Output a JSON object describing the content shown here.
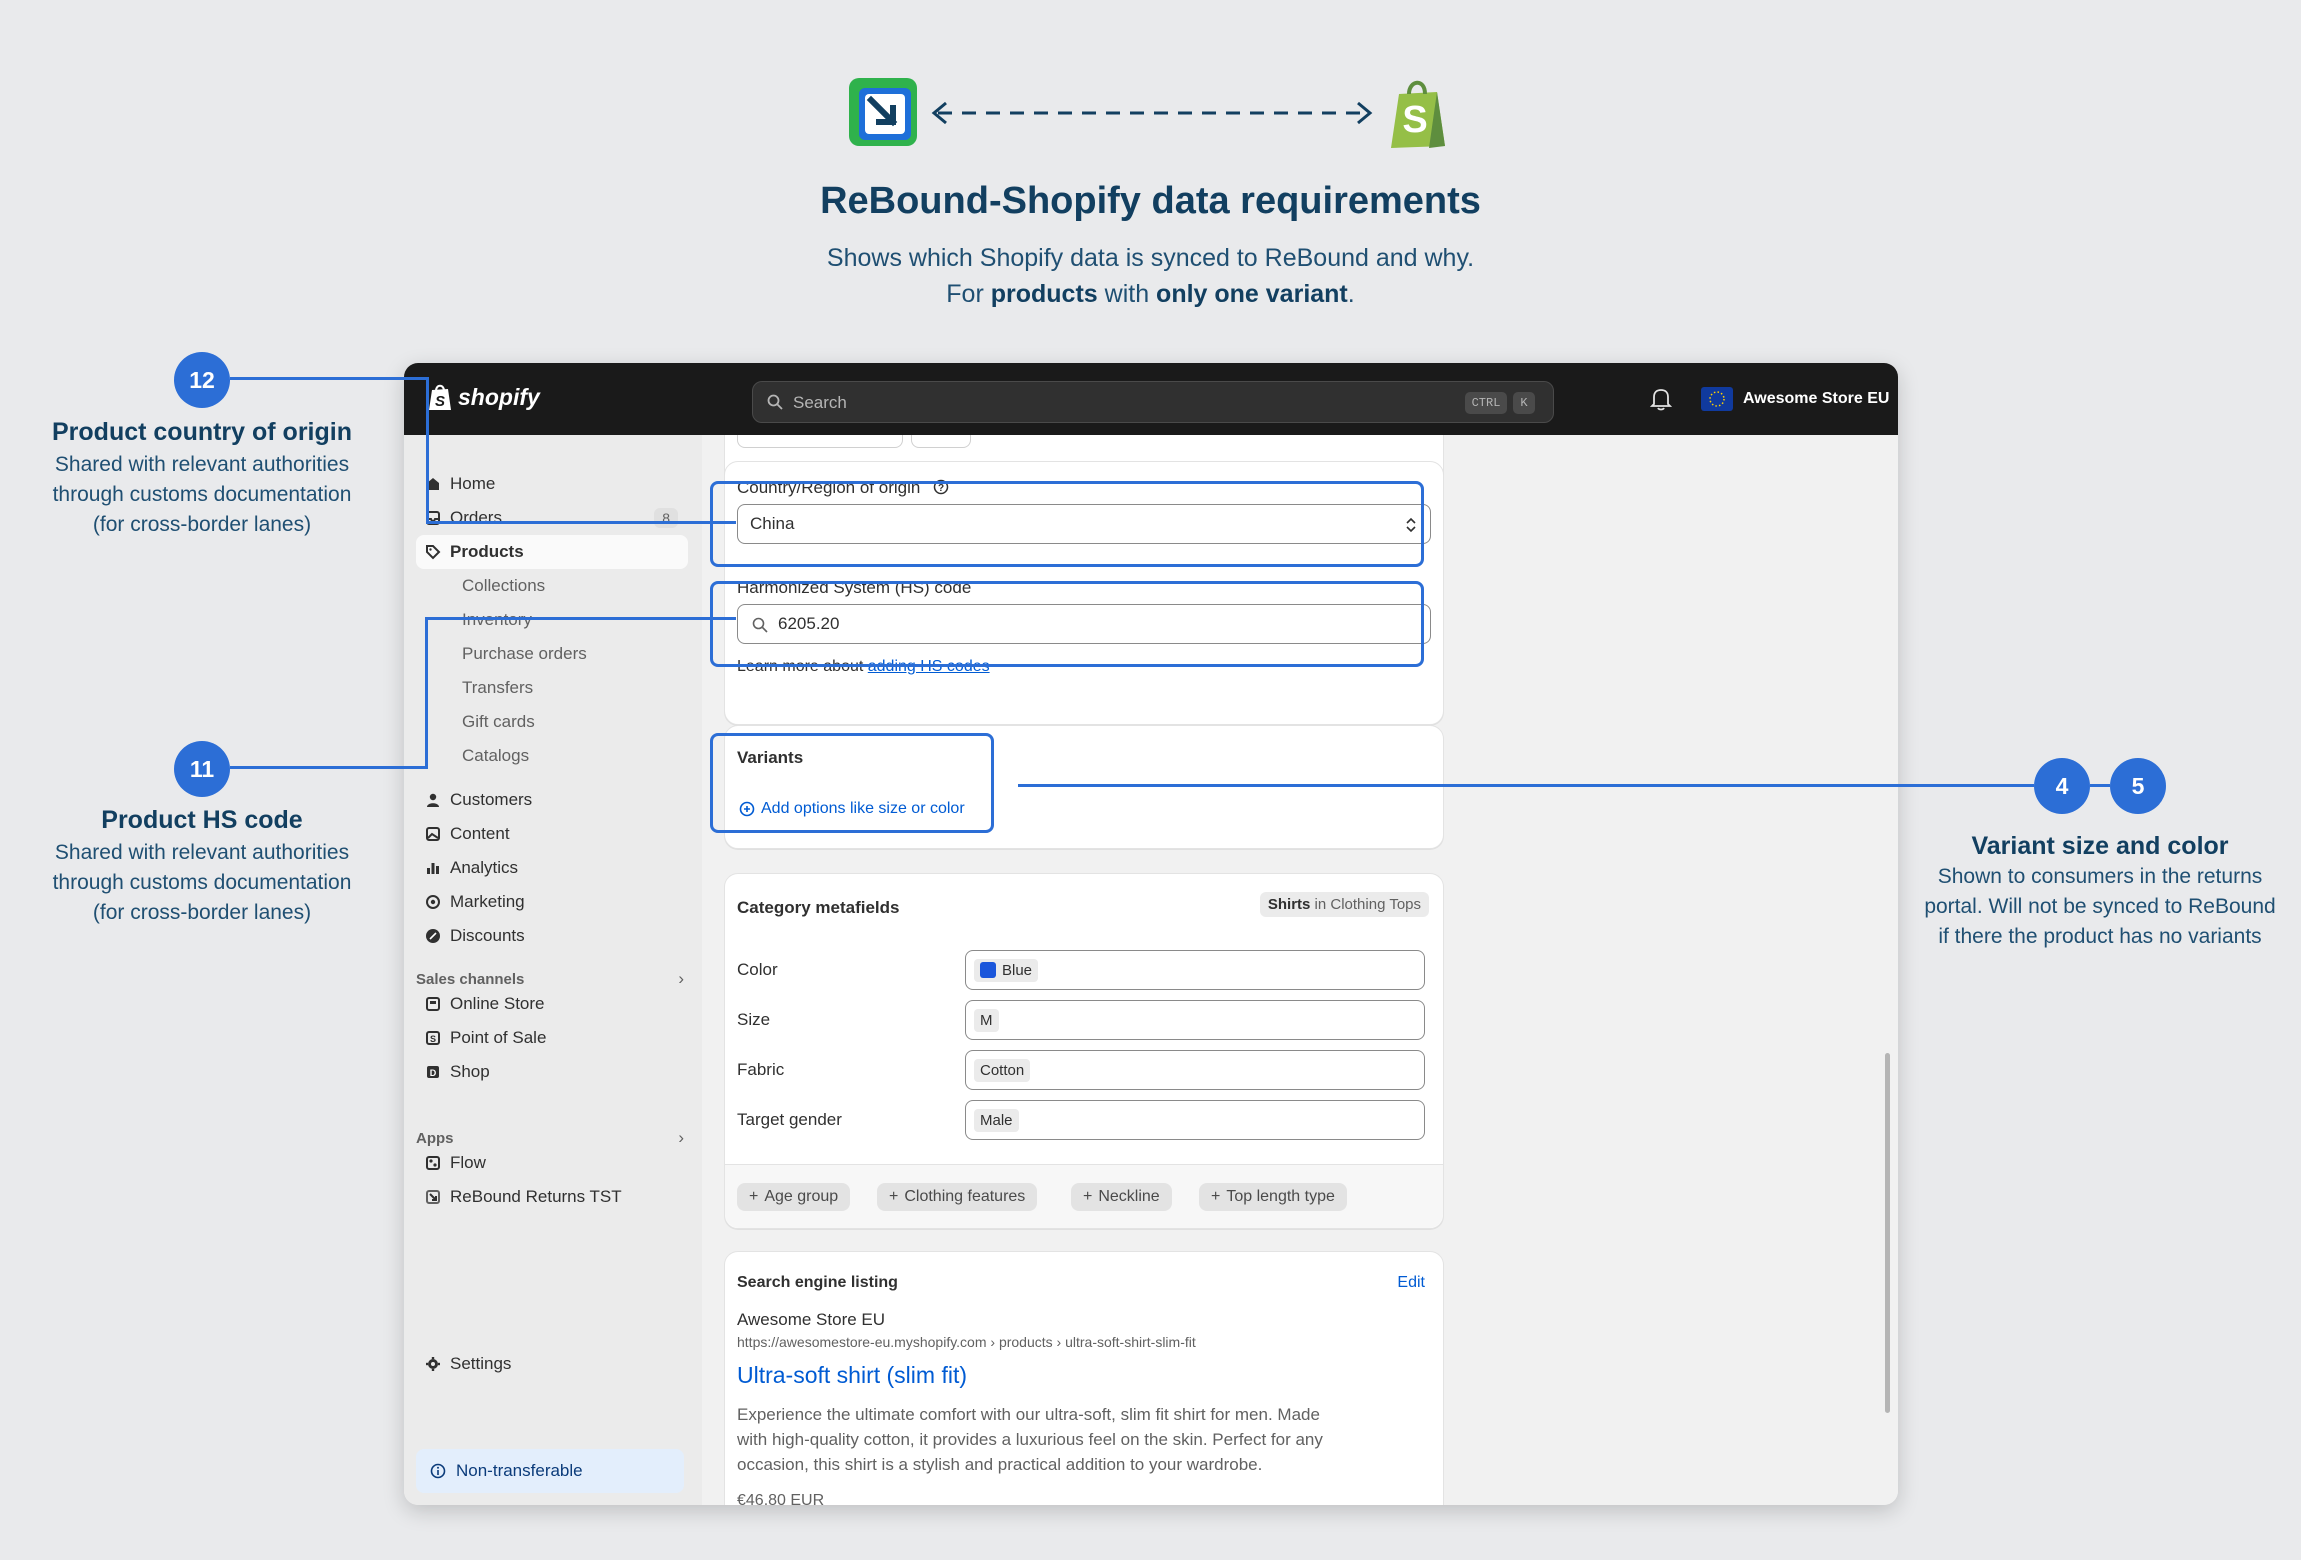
{
  "header": {
    "title": "ReBound-Shopify data requirements",
    "subtitle_line1": "Shows which Shopify data is synced to ReBound and why.",
    "subtitle_for": "For ",
    "subtitle_products": "products",
    "subtitle_with": " with ",
    "subtitle_variant": "only one variant",
    "subtitle_end": "."
  },
  "annotations": {
    "a12": {
      "badge": "12",
      "title": "Product country of origin",
      "lines": [
        "Shared with relevant authorities",
        "through customs documentation",
        "(for cross-border lanes)"
      ]
    },
    "a11": {
      "badge": "11",
      "title": "Product HS code",
      "lines": [
        "Shared with relevant authorities",
        "through customs documentation",
        "(for cross-border lanes)"
      ]
    },
    "a45": {
      "badge1": "4",
      "badge2": "5",
      "title": "Variant size and color",
      "lines": [
        "Shown to consumers in the returns",
        "portal. Will not be synced to ReBound",
        "if there the product has no variants"
      ]
    }
  },
  "topbar": {
    "brand": "shopify",
    "search_placeholder": "Search",
    "kbd1": "CTRL",
    "kbd2": "K",
    "store_name": "Awesome Store EU"
  },
  "sidebar": {
    "home": "Home",
    "orders": "Orders",
    "orders_count": "8",
    "products": "Products",
    "collections": "Collections",
    "inventory": "Inventory",
    "purchase_orders": "Purchase orders",
    "transfers": "Transfers",
    "gift_cards": "Gift cards",
    "catalogs": "Catalogs",
    "customers": "Customers",
    "content": "Content",
    "analytics": "Analytics",
    "marketing": "Marketing",
    "discounts": "Discounts",
    "sales_channels": "Sales channels",
    "online_store": "Online Store",
    "point_of_sale": "Point of Sale",
    "shop": "Shop",
    "apps": "Apps",
    "flow": "Flow",
    "rebound": "ReBound Returns TST",
    "settings": "Settings",
    "non_transferable": "Non-transferable"
  },
  "product": {
    "country_label": "Country/Region of origin",
    "country_value": "China",
    "hs_label": "Harmonized System (HS) code",
    "hs_value": "6205.20",
    "learn_more": "Learn more about ",
    "learn_link": "adding HS codes",
    "variants_title": "Variants",
    "variants_add": "Add options like size or color",
    "metafields_title": "Category metafields",
    "category_bold": "Shirts",
    "category_rest": " in Clothing Tops",
    "metafields": [
      {
        "label": "Color",
        "value": "Blue",
        "swatch": "#1a56db"
      },
      {
        "label": "Size",
        "value": "M"
      },
      {
        "label": "Fabric",
        "value": "Cotton"
      },
      {
        "label": "Target gender",
        "value": "Male"
      }
    ],
    "chips": [
      "Age group",
      "Clothing features",
      "Neckline",
      "Top length type"
    ],
    "seo_title": "Search engine listing",
    "seo_edit": "Edit",
    "seo_store": "Awesome Store EU",
    "seo_url": "https://awesomestore-eu.myshopify.com › products › ultra-soft-shirt-slim-fit",
    "seo_heading": "Ultra-soft shirt (slim fit)",
    "seo_desc": [
      "Experience the ultimate comfort with our ultra-soft, slim fit shirt for men. Made",
      "with high-quality cotton, it provides a luxurious feel on the skin. Perfect for any",
      "occasion, this shirt is a stylish and practical addition to your wardrobe."
    ],
    "seo_price": "€46.80 EUR"
  },
  "colors": {
    "accent": "#2c6ed6",
    "title": "#123f60",
    "shopify_green": "#95bf47",
    "rebound_green": "#2fb24c"
  }
}
